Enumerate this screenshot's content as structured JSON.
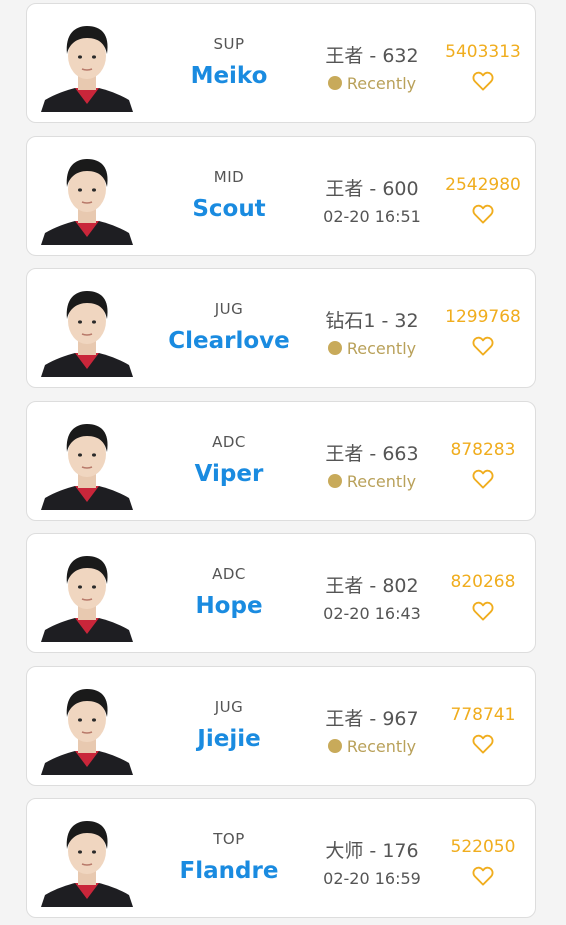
{
  "accent_color": "#1a8be0",
  "count_color": "#f0ad1e",
  "status_dot_color": "#c8aa5a",
  "players": [
    {
      "role": "SUP",
      "name": "Meiko",
      "rank": "王者 - 632",
      "status": "Recently",
      "recent": true,
      "count": "5403313",
      "icon": "heart-outline-icon"
    },
    {
      "role": "MID",
      "name": "Scout",
      "rank": "王者 - 600",
      "status": "02-20 16:51",
      "recent": false,
      "count": "2542980",
      "icon": "heart-outline-icon"
    },
    {
      "role": "JUG",
      "name": "Clearlove",
      "rank": "钻石1 - 32",
      "status": "Recently",
      "recent": true,
      "count": "1299768",
      "icon": "heart-outline-icon"
    },
    {
      "role": "ADC",
      "name": "Viper",
      "rank": "王者 - 663",
      "status": "Recently",
      "recent": true,
      "count": "878283",
      "icon": "heart-outline-icon"
    },
    {
      "role": "ADC",
      "name": "Hope",
      "rank": "王者 - 802",
      "status": "02-20 16:43",
      "recent": false,
      "count": "820268",
      "icon": "heart-outline-icon"
    },
    {
      "role": "JUG",
      "name": "Jiejie",
      "rank": "王者 - 967",
      "status": "Recently",
      "recent": true,
      "count": "778741",
      "icon": "heart-outline-icon"
    },
    {
      "role": "TOP",
      "name": "Flandre",
      "rank": "大师 - 176",
      "status": "02-20 16:59",
      "recent": false,
      "count": "522050",
      "icon": "heart-outline-icon"
    }
  ]
}
